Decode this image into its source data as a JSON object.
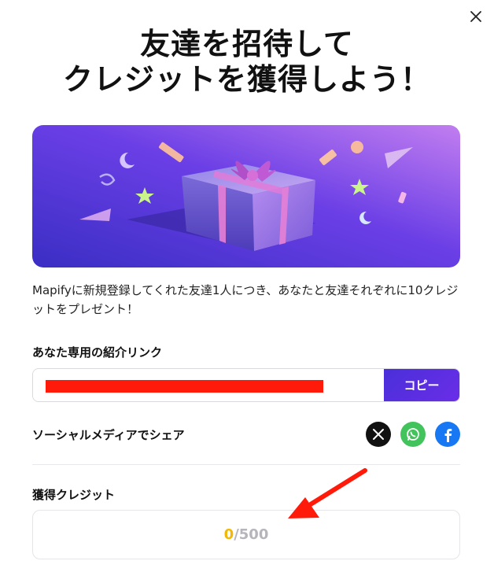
{
  "modal": {
    "title_line1": "友達を招待して",
    "title_line2": "クレジットを獲得しよう！",
    "close_icon": "close-icon"
  },
  "description": "Mapifyに新規登録してくれた友達1人につき、あなたと友達それぞれに10クレジットをプレゼント！",
  "referral": {
    "label": "あなた専用の紹介リンク",
    "link_value": "",
    "copy_button": "コピー"
  },
  "share": {
    "label": "ソーシャルメディアでシェア",
    "icons": [
      "x-icon",
      "whatsapp-icon",
      "facebook-icon"
    ]
  },
  "credits": {
    "label": "獲得クレジット",
    "current": "0",
    "separator": "/",
    "total": "500"
  },
  "colors": {
    "accent": "#5b2ee0",
    "credit_current": "#f2b807",
    "annotation_arrow": "#ff1a0a",
    "redaction": "#ff1a0a"
  }
}
